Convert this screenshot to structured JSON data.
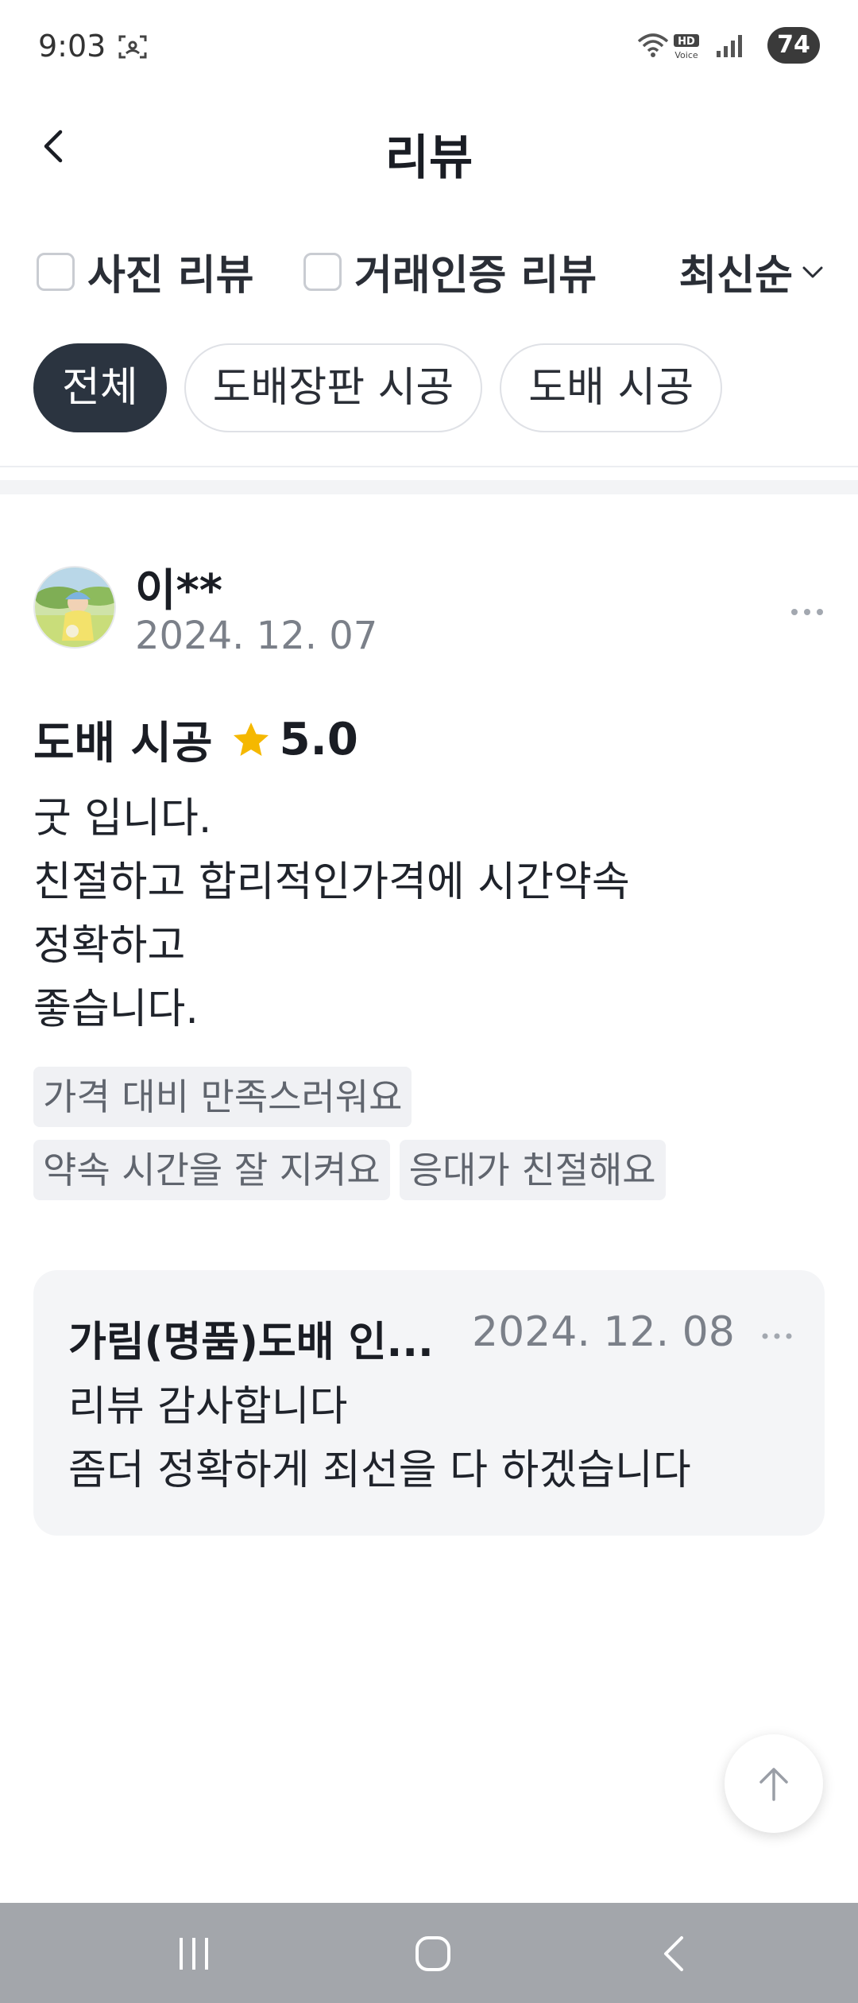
{
  "status_bar": {
    "time": "9:03",
    "hd_label": "HD",
    "voice_label": "Voice",
    "battery": "74"
  },
  "header": {
    "title": "리뷰"
  },
  "filters": {
    "photo_review": "사진 리뷰",
    "verified_review": "거래인증 리뷰",
    "sort": "최신순"
  },
  "chips": [
    {
      "label": "전체",
      "active": true
    },
    {
      "label": "도배장판 시공",
      "active": false
    },
    {
      "label": "도배 시공",
      "active": false
    }
  ],
  "review": {
    "reviewer": "이**",
    "date": "2024. 12. 07",
    "service": "도배 시공",
    "rating": "5.0",
    "lines": [
      "굿 입니다.",
      "친절하고 합리적인가격에 시간약속",
      "정확하고",
      "좋습니다."
    ],
    "tags": [
      "가격 대비 만족스러워요",
      "약속 시간을 잘 지켜요",
      "응대가 친절해요"
    ]
  },
  "reply": {
    "name": "가림(명품)도배 인...",
    "date": "2024. 12. 08",
    "lines": [
      "리뷰 감사합니다",
      "좀더 정확하게 죄선을 다 하겠습니다"
    ]
  },
  "colors": {
    "active_chip": "#2b3440",
    "star": "#f5b800",
    "tag_bg": "#f0f1f4",
    "reply_bg": "#f4f5f7",
    "nav_bar": "#a3a6ab"
  }
}
